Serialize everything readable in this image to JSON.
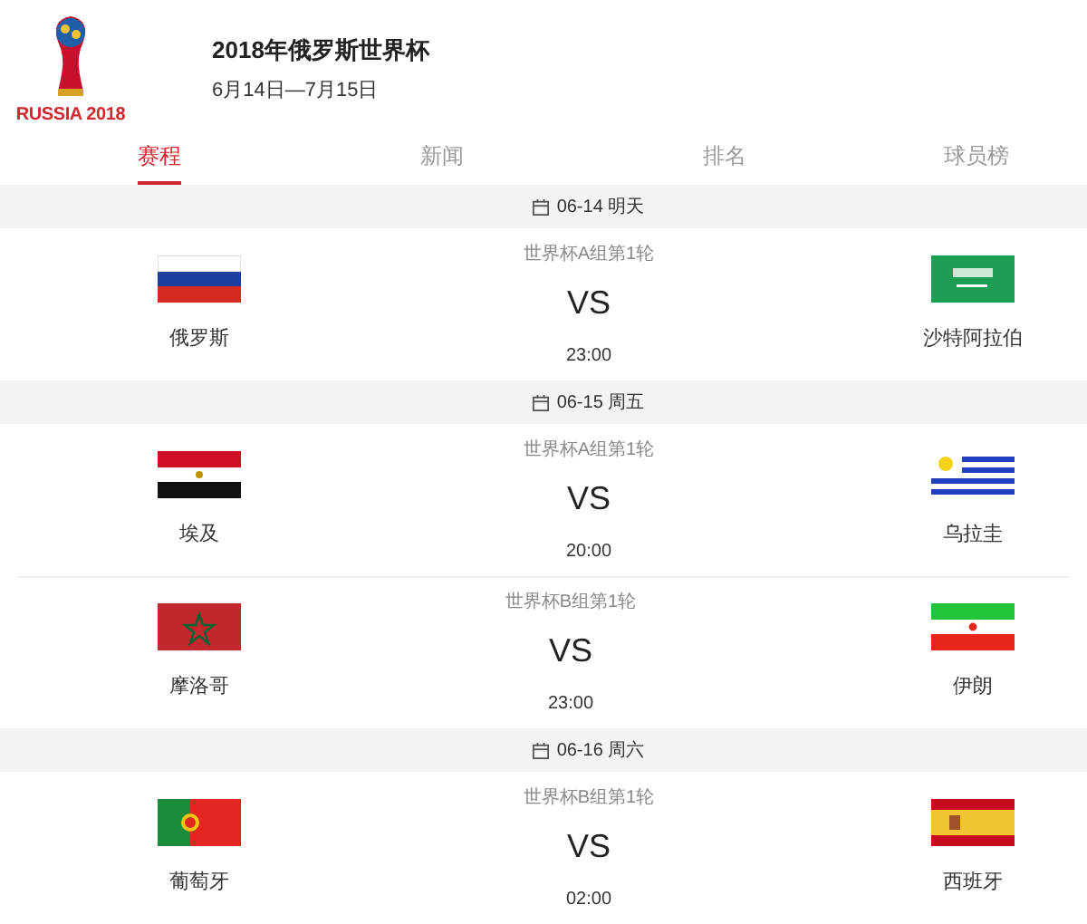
{
  "header": {
    "logo_text": "RUSSIA 2018",
    "title": "2018年俄罗斯世界杯",
    "dates": "6月14日—7月15日"
  },
  "tabs": [
    {
      "label": "赛程",
      "selected": true
    },
    {
      "label": "新闻",
      "selected": false
    },
    {
      "label": "排名",
      "selected": false
    },
    {
      "label": "球员榜",
      "selected": false
    }
  ],
  "days": [
    {
      "date": "06-14 明天",
      "matches": [
        {
          "round": "世界杯A组第1轮",
          "home": "俄罗斯",
          "vs": "VS",
          "time": "23:00",
          "away": "沙特阿拉伯"
        }
      ]
    },
    {
      "date": "06-15 周五",
      "matches": [
        {
          "round": "世界杯A组第1轮",
          "home": "埃及",
          "vs": "VS",
          "time": "20:00",
          "away": "乌拉圭"
        },
        {
          "round": "世界杯B组第1轮",
          "home": "摩洛哥",
          "vs": "VS",
          "time": "23:00",
          "away": "伊朗"
        }
      ]
    },
    {
      "date": "06-16 周六",
      "matches": [
        {
          "round": "世界杯B组第1轮",
          "home": "葡萄牙",
          "vs": "VS",
          "time": "02:00",
          "away": "西班牙"
        }
      ]
    }
  ]
}
